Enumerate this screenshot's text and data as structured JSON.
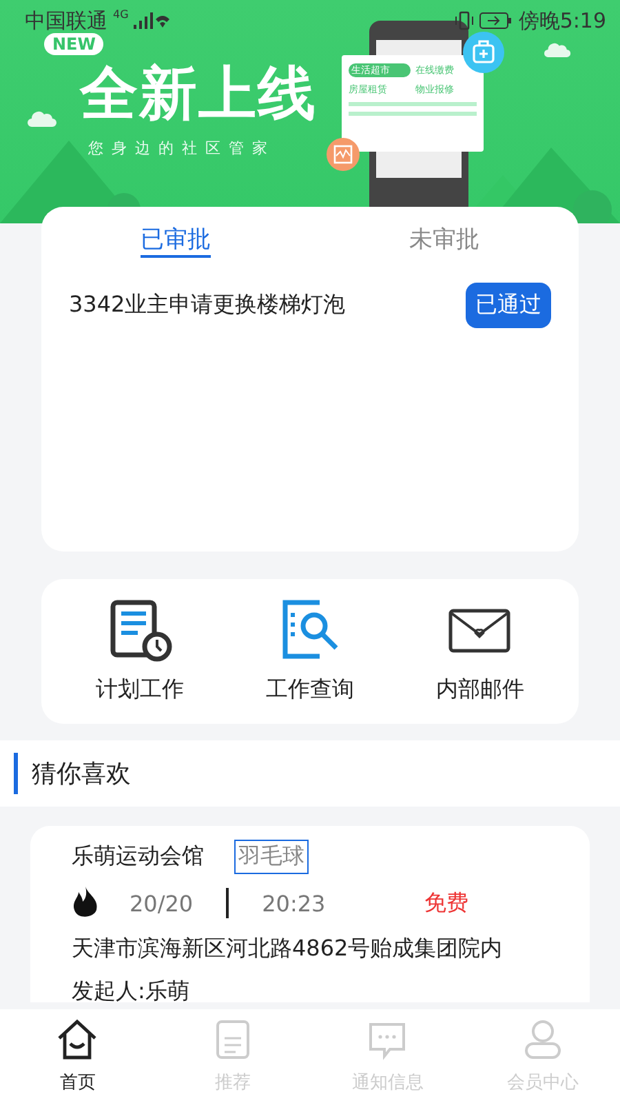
{
  "status_bar": {
    "carrier": "中国联通",
    "network": "4G",
    "time": "傍晚5:19"
  },
  "banner": {
    "badge": "NEW",
    "title": "全新上线",
    "subtitle": "您身边的社区管家",
    "features": [
      "生活超市",
      "在线缴费",
      "房屋租赁",
      "物业报修"
    ]
  },
  "approval": {
    "tabs": [
      {
        "label": "已审批",
        "selected": true
      },
      {
        "label": "未审批",
        "selected": false
      }
    ],
    "items": [
      {
        "title": "3342业主申请更换楼梯灯泡",
        "status": "已通过"
      }
    ]
  },
  "shortcuts": [
    {
      "label": "计划工作",
      "kind": "plan"
    },
    {
      "label": "工作查询",
      "kind": "search"
    },
    {
      "label": "内部邮件",
      "kind": "mail"
    }
  ],
  "section_title": "猜你喜欢",
  "activities": [
    {
      "venue": "乐萌运动会馆",
      "tag": "羽毛球",
      "count": "20/20",
      "time": "20:23",
      "price": "免费",
      "address": "天津市滨海新区河北路4862号贻成集团院内",
      "organizer": "发起人:乐萌"
    }
  ],
  "bottom_nav": [
    {
      "label": "首页",
      "kind": "home",
      "selected": true
    },
    {
      "label": "推荐",
      "kind": "doc",
      "selected": false
    },
    {
      "label": "通知信息",
      "kind": "chat",
      "selected": false
    },
    {
      "label": "会员中心",
      "kind": "user",
      "selected": false
    }
  ]
}
